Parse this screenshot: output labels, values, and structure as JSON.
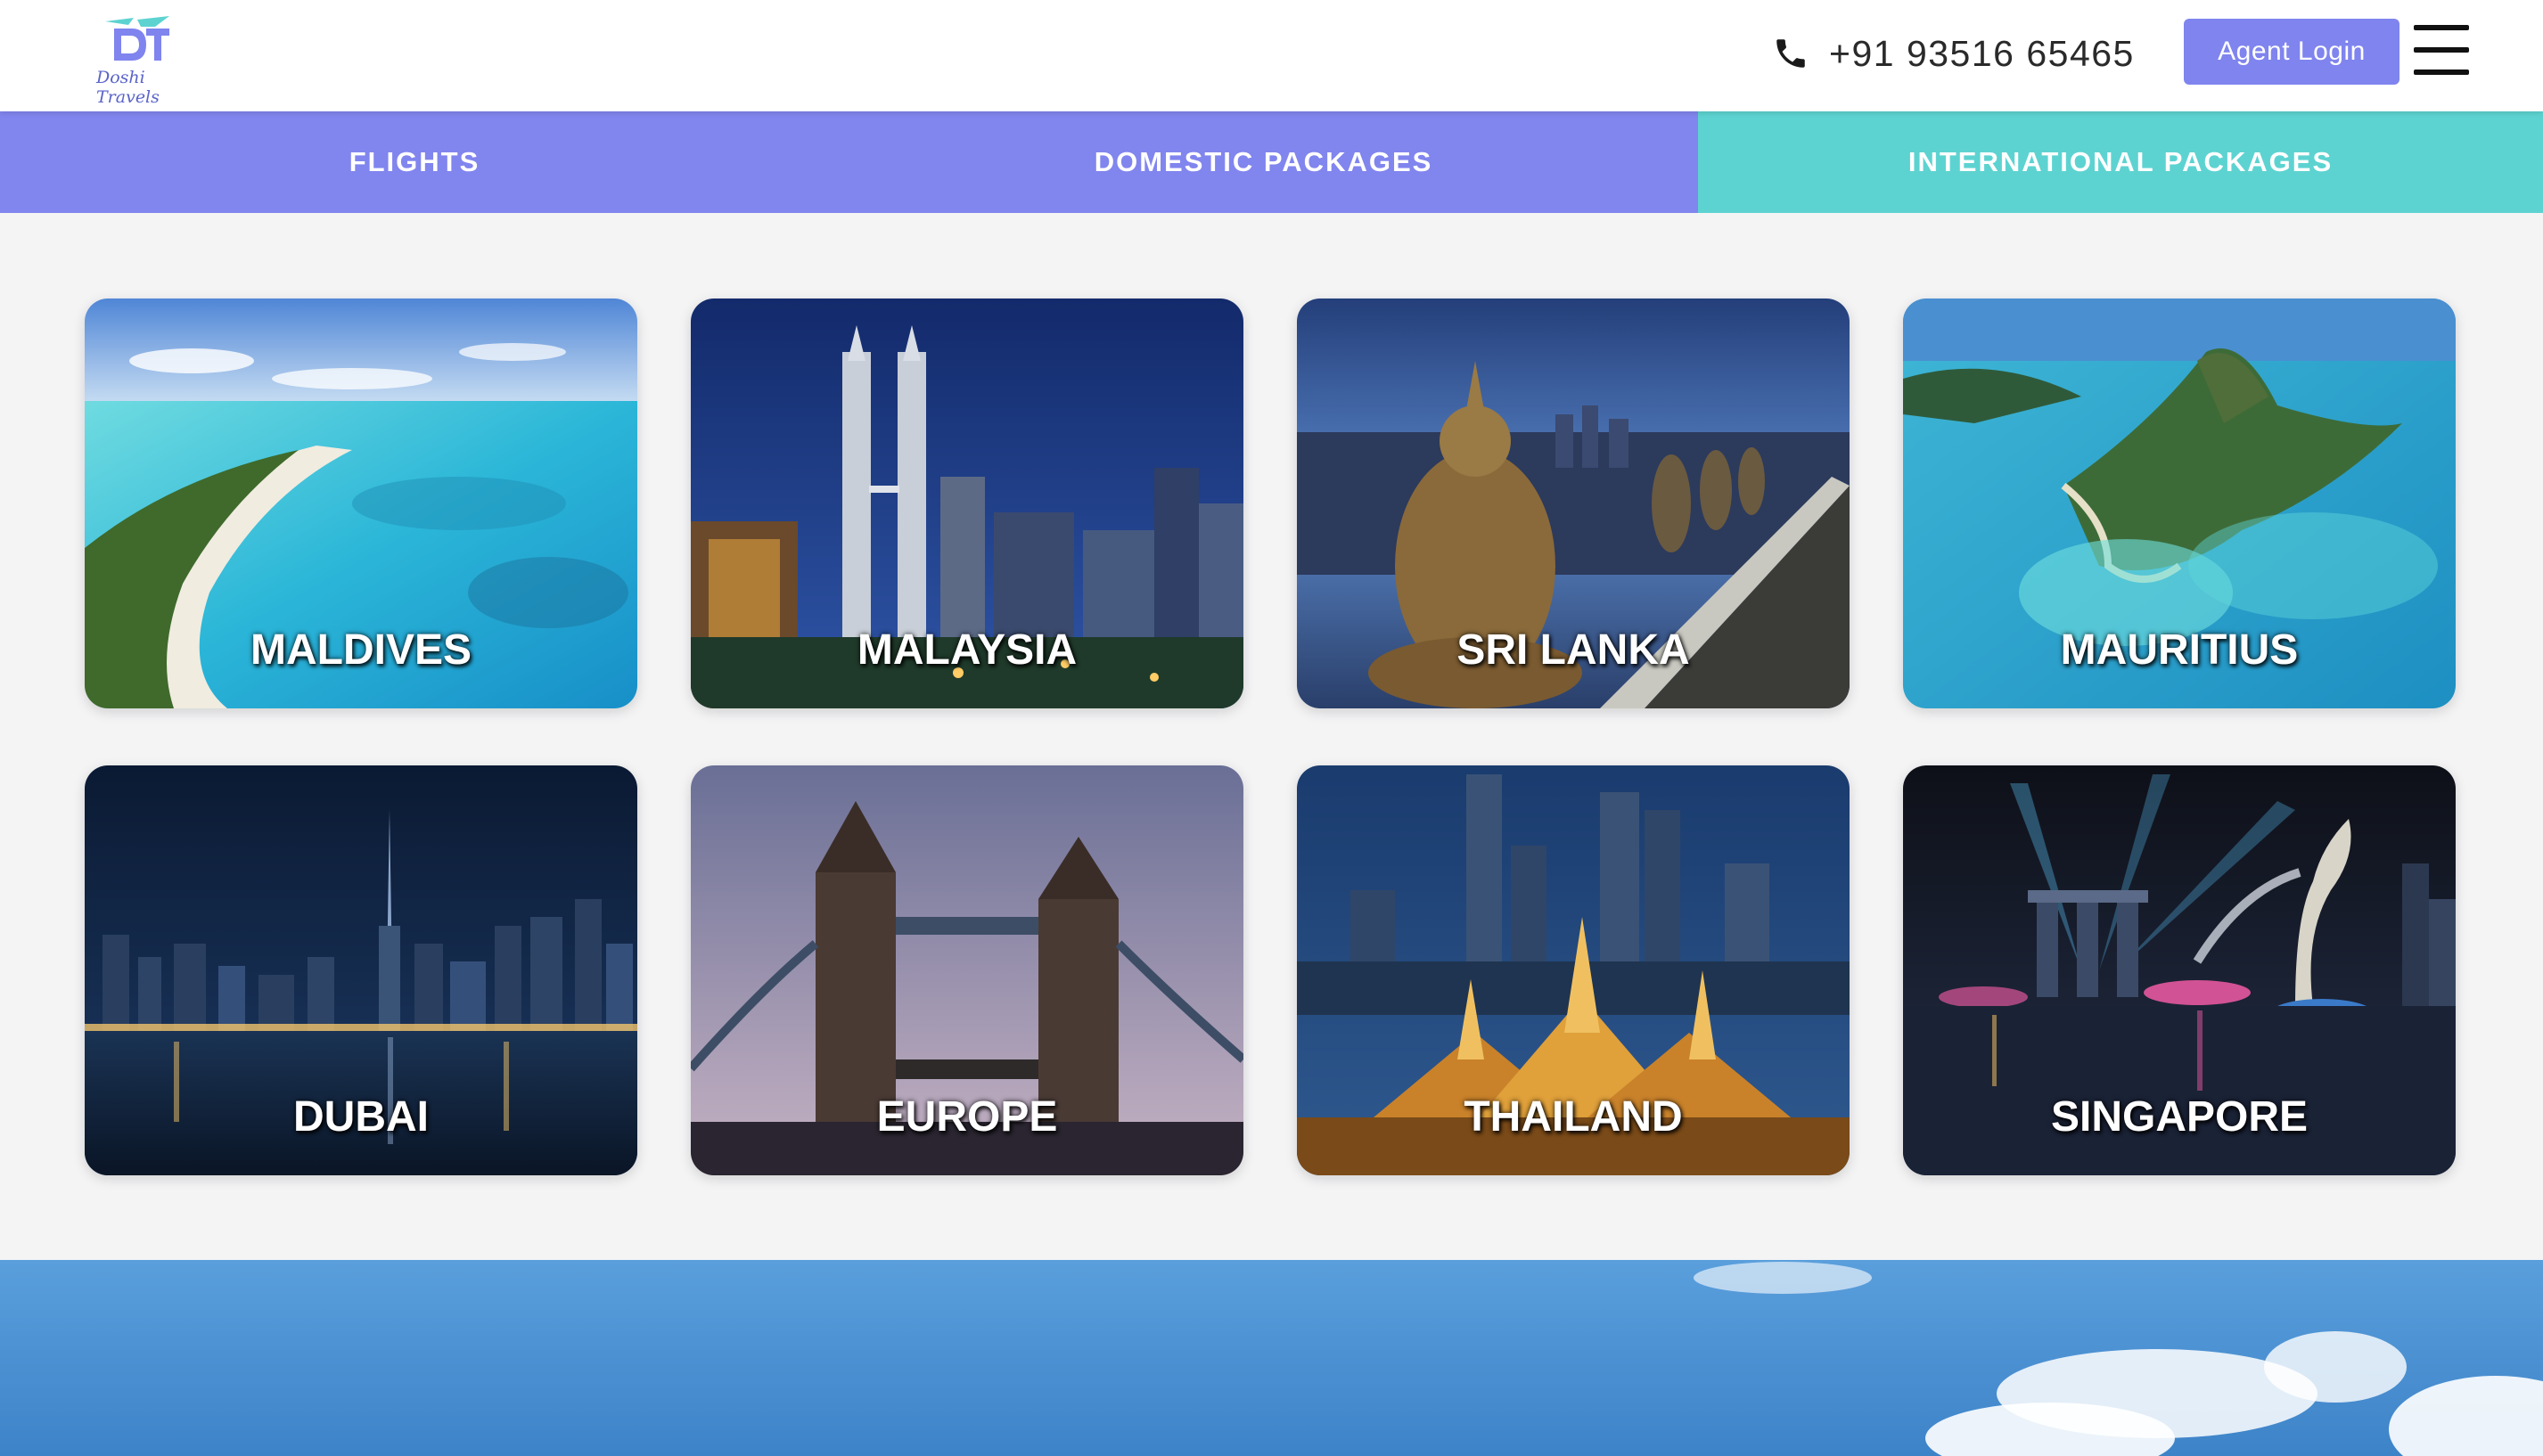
{
  "header": {
    "logo_letters": "DT",
    "logo_text": "Doshi Travels",
    "phone_icon": "phone-icon",
    "phone_number": "+91 93516 65465",
    "agent_login_label": "Agent Login",
    "menu_icon": "hamburger-menu-icon"
  },
  "tabs": [
    {
      "label": "FLIGHTS",
      "active": false
    },
    {
      "label": "DOMESTIC PACKAGES",
      "active": false
    },
    {
      "label": "INTERNATIONAL PACKAGES",
      "active": true
    }
  ],
  "destinations": [
    {
      "label": "MALDIVES"
    },
    {
      "label": "MALAYSIA"
    },
    {
      "label": "SRI LANKA"
    },
    {
      "label": "MAURITIUS"
    },
    {
      "label": "DUBAI"
    },
    {
      "label": "EUROPE"
    },
    {
      "label": "THAILAND"
    },
    {
      "label": "SINGAPORE"
    }
  ],
  "colors": {
    "accent": "#8185ee",
    "active_tab": "#5dd3d1",
    "page_bg": "#f4f4f5"
  }
}
